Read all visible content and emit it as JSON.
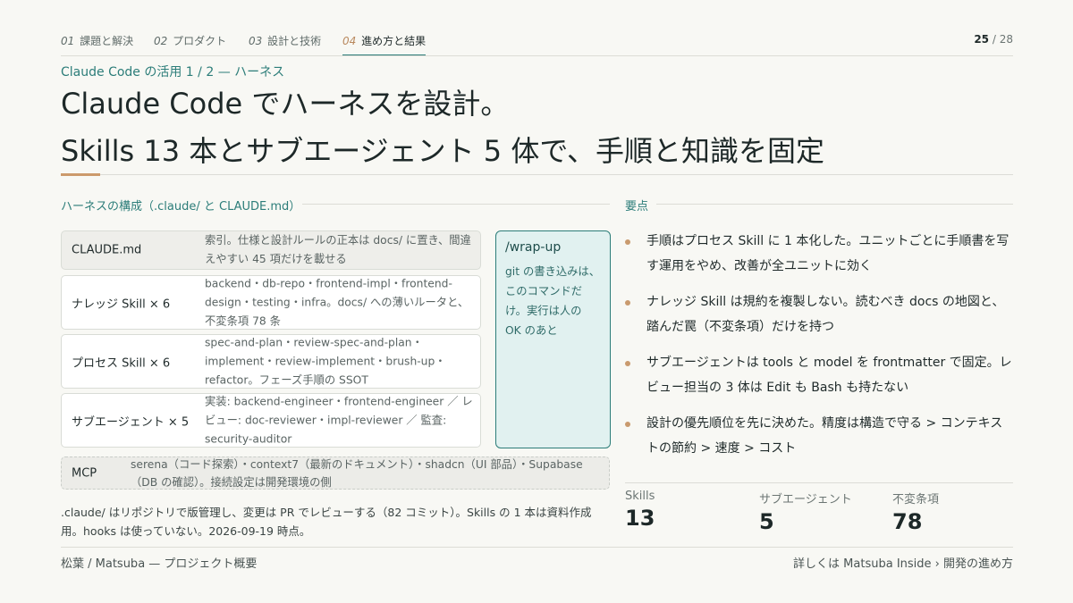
{
  "nav": {
    "tabs": [
      {
        "num": "01",
        "label": "課題と解決"
      },
      {
        "num": "02",
        "label": "プロダクト"
      },
      {
        "num": "03",
        "label": "設計と技術"
      },
      {
        "num": "04",
        "label": "進め方と結果"
      }
    ],
    "active_tab": 3,
    "page_current": "25",
    "page_total": "/ 28"
  },
  "slide": {
    "eyebrow": "Claude Code の活用 1 / 2 — ハーネス",
    "title_line1": "Claude Code でハーネスを設計。",
    "title_line2": "Skills 13 本とサブエージェント 5 体で、手順と知識を固定"
  },
  "harness": {
    "heading": "ハーネスの構成（.claude/ と CLAUDE.md）",
    "rows": [
      {
        "label": "CLAUDE.md",
        "desc": "索引。仕様と設計ルールの正本は docs/ に置き、間違えやすい 45 項だけを載せる"
      },
      {
        "label": "ナレッジ Skill × 6",
        "desc": "backend・db-repo・frontend-impl・frontend-design・testing・infra。docs/ への薄いルータと、不変条項 78 条"
      },
      {
        "label": "プロセス Skill × 6",
        "desc": "spec-and-plan・review-spec-and-plan・implement・review-implement・brush-up・refactor。フェーズ手順の SSOT"
      },
      {
        "label": "サブエージェント × 5",
        "desc": "実装: backend-engineer・frontend-engineer ／ レビュー: doc-reviewer・impl-reviewer ／ 監査: security-auditor"
      }
    ],
    "mcp": {
      "label": "MCP",
      "desc": "serena（コード探索）・context7（最新のドキュメント）・shadcn（UI 部品）・Supabase（DB の確認）。接続設定は開発環境の側"
    },
    "wrapup": {
      "title": "/wrap-up",
      "desc": "git の書き込みは、このコマンドだけ。実行は人の OK のあと"
    },
    "note": ".claude/ はリポジトリで版管理し、変更は PR でレビューする（82 コミット）。Skills の 1 本は資料作成用。hooks は使っていない。2026-09-19 時点。"
  },
  "points": {
    "heading": "要点",
    "items": [
      "手順はプロセス Skill に 1 本化した。ユニットごとに手順書を写す運用をやめ、改善が全ユニットに効く",
      "ナレッジ Skill は規約を複製しない。読むべき docs の地図と、踏んだ罠（不変条項）だけを持つ",
      "サブエージェントは tools と model を frontmatter で固定。レビュー担当の 3 体は Edit も Bash も持たない",
      "設計の優先順位を先に決めた。精度は構造で守る > コンテキストの節約 > 速度 > コスト"
    ]
  },
  "stats": [
    {
      "label": "Skills",
      "value": "13"
    },
    {
      "label": "サブエージェント",
      "value": "5"
    },
    {
      "label": "不変条項",
      "value": "78"
    }
  ],
  "footer": {
    "left": "松葉 / Matsuba — プロジェクト概要",
    "right": "詳しくは Matsuba Inside › 開発の進め方"
  },
  "colors": {
    "accent_teal": "#2c7d79",
    "accent_tan": "#cc9a6b",
    "background": "#f8f8f4"
  }
}
